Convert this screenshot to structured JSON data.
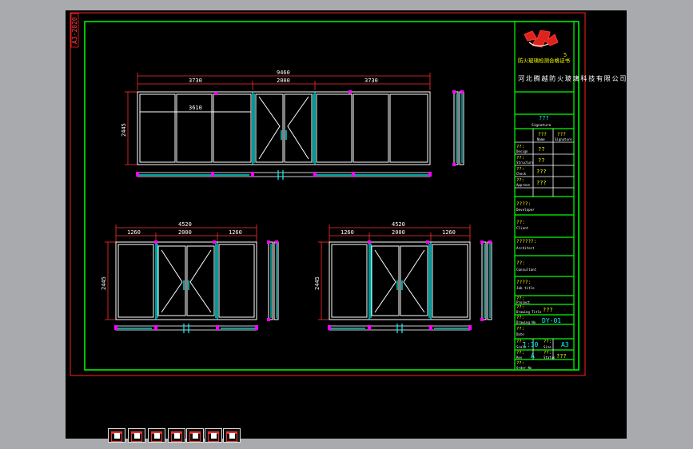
{
  "sheet": {
    "vertical_label": "A3-2020",
    "company_cn": "河北腾越防火玻璃科技有限公司",
    "logo_caption": "防火玻璃检测合格证书",
    "signature_label": "???",
    "signature_sub": "Signature",
    "name_col": "???",
    "name_col_sub": "Name",
    "sig_col": "???",
    "sig_col_sub": "Signature",
    "rows": [
      {
        "label": "??:",
        "sub": "Design",
        "value": "??"
      },
      {
        "label": "??:",
        "sub": "Structure",
        "value": "??"
      },
      {
        "label": "??:",
        "sub": "Check",
        "value": "???"
      },
      {
        "label": "??:",
        "sub": "Approve",
        "value": "???"
      }
    ],
    "developer_label": "????:",
    "developer_sub": "Developer",
    "client_label": "??:",
    "client_sub": "Client",
    "architect_label": "??????:",
    "architect_sub": "Architect",
    "consultant_label": "??:",
    "consultant_sub": "Consultant",
    "job_title_label": "????:",
    "job_title_sub": "Job title",
    "project_label": "??:",
    "project_sub": "Project",
    "drawing_title_label": "??:",
    "drawing_title_sub": "Drawing Title",
    "drawing_title_value": "???",
    "drawing_no_label": "??:",
    "drawing_no_sub": "Drawing No",
    "drawing_no_value": "DY-01",
    "date_label": "??:",
    "date_sub": "Date",
    "scale_label": "??:",
    "scale_sub": "Scale",
    "scale_value": "1:30",
    "size_label": "??:",
    "size_sub": "Size",
    "size_value": "A3",
    "rev_label": "??:",
    "rev_sub": "Rev",
    "rev_value": "A",
    "status_label": "??:",
    "status_sub": "Status",
    "status_value": "???",
    "order_label": "??:",
    "order_sub": "Order No"
  },
  "top_elevation": {
    "overall": "9460",
    "left": "3730",
    "center": "2000",
    "right": "3730",
    "inner": "3610",
    "height": "2445"
  },
  "bottom_left": {
    "overall": "4520",
    "left": "1260",
    "center": "2000",
    "right": "1260",
    "height": "2445"
  },
  "bottom_right": {
    "overall": "4520",
    "left": "1260",
    "center": "2000",
    "right": "1260",
    "height": "2445"
  },
  "colors": {
    "background": "#a9aaae",
    "canvas": "#000000",
    "frame_green": "#00ff00",
    "outer_red": "#ff2020",
    "dim_red": "#ff3030",
    "line_white": "#ffffff",
    "cyan": "#00ffff",
    "magenta": "#ff00ff",
    "yellow": "#ffff00"
  },
  "toolbar": {
    "sheet_tabs": [
      "sheet-tab-1",
      "sheet-tab-2",
      "sheet-tab-3",
      "sheet-tab-4",
      "sheet-tab-5",
      "sheet-tab-6",
      "sheet-tab-7"
    ]
  }
}
